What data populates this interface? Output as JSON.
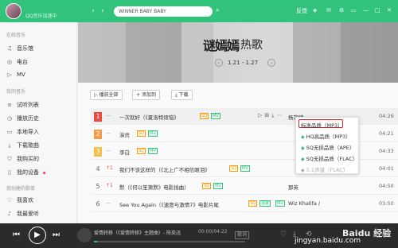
{
  "topbar": {
    "username": "",
    "userstatus": "QQ音乐加速中",
    "search_value": "WINNER BABY BABY",
    "right_items": [
      "反馈"
    ]
  },
  "sidebar": {
    "section1": "在线音乐",
    "items1": [
      {
        "label": "音乐馆",
        "icon": "music-hall-icon"
      },
      {
        "label": "电台",
        "icon": "radio-icon"
      },
      {
        "label": "MV",
        "icon": "mv-icon"
      }
    ],
    "section2": "我的音乐",
    "items2": [
      {
        "label": "试听列表",
        "icon": "list-icon"
      },
      {
        "label": "播放历史",
        "icon": "history-icon"
      },
      {
        "label": "本地导入",
        "icon": "local-icon"
      },
      {
        "label": "下载歌曲",
        "icon": "download-icon"
      },
      {
        "label": "我购买的",
        "icon": "cart-icon"
      },
      {
        "label": "我的设备",
        "icon": "device-icon"
      }
    ],
    "section3": "我创建的歌单",
    "items3": [
      {
        "label": "我喜欢",
        "icon": "heart-icon"
      },
      {
        "label": "我最爱听",
        "icon": "playlist-icon"
      }
    ]
  },
  "banner": {
    "logo": "谜嫣嫣",
    "title": "热歌",
    "date": "1.21 - 1.27"
  },
  "toolbar": {
    "play_all": "播放全部",
    "add_to": "添加到",
    "download": "下载"
  },
  "songs": [
    {
      "rank": "1",
      "trend": "—",
      "title": "一次就好（《夏洛特烦恼》",
      "tags": [
        "SQ",
        "MV"
      ],
      "artist": "杨宗纬",
      "dur": "04:26"
    },
    {
      "rank": "2",
      "trend": "—",
      "title": "演员",
      "tags": [
        "SQ",
        "MV"
      ],
      "artist": "",
      "dur": "04:21"
    },
    {
      "rank": "3",
      "trend": "—",
      "title": "李白",
      "tags": [
        "SQ",
        "MV"
      ],
      "artist": "",
      "dur": "04:33"
    },
    {
      "rank": "4",
      "trend": "1",
      "title": "我们不该这样的（《北上广不相信眼泪》",
      "tags": [
        "SQ",
        "MV"
      ],
      "artist": "",
      "dur": "04:01"
    },
    {
      "rank": "5",
      "trend": "1",
      "title": "默（《何以笙箫默》电影插曲）",
      "tags": [
        "SQ",
        "MV"
      ],
      "artist": "那英",
      "dur": "04:50"
    },
    {
      "rank": "6",
      "trend": "—",
      "title": "See You Again（《速度与激情7》电影片尾",
      "tags": [
        "SQ",
        "独家",
        "MV"
      ],
      "artist": "Wiz Khalifa /",
      "dur": "03:50"
    }
  ],
  "popup": {
    "items": [
      {
        "label": "标准品质（MP3）",
        "green": false,
        "grey": false
      },
      {
        "label": "HQ高品质（MP3）",
        "green": true,
        "grey": false
      },
      {
        "label": "SQ无损品质（APE）",
        "green": true,
        "grey": false
      },
      {
        "label": "SQ无损品质（FLAC）",
        "green": true,
        "grey": false
      },
      {
        "label": "5.1声道（FLAC）",
        "green": false,
        "grey": true
      }
    ]
  },
  "player": {
    "now_playing": "爱情转移（《爱情转移》主题曲）- 陈奕迅",
    "time": "00:00/04:22",
    "lyrics_btn": "歌词",
    "progress": 0.02
  },
  "watermark": {
    "logo": "Baidu 经验",
    "url": "jingyan.baidu.com"
  },
  "colors": {
    "accent": "#31c27c",
    "highlight": "#dd2222"
  }
}
